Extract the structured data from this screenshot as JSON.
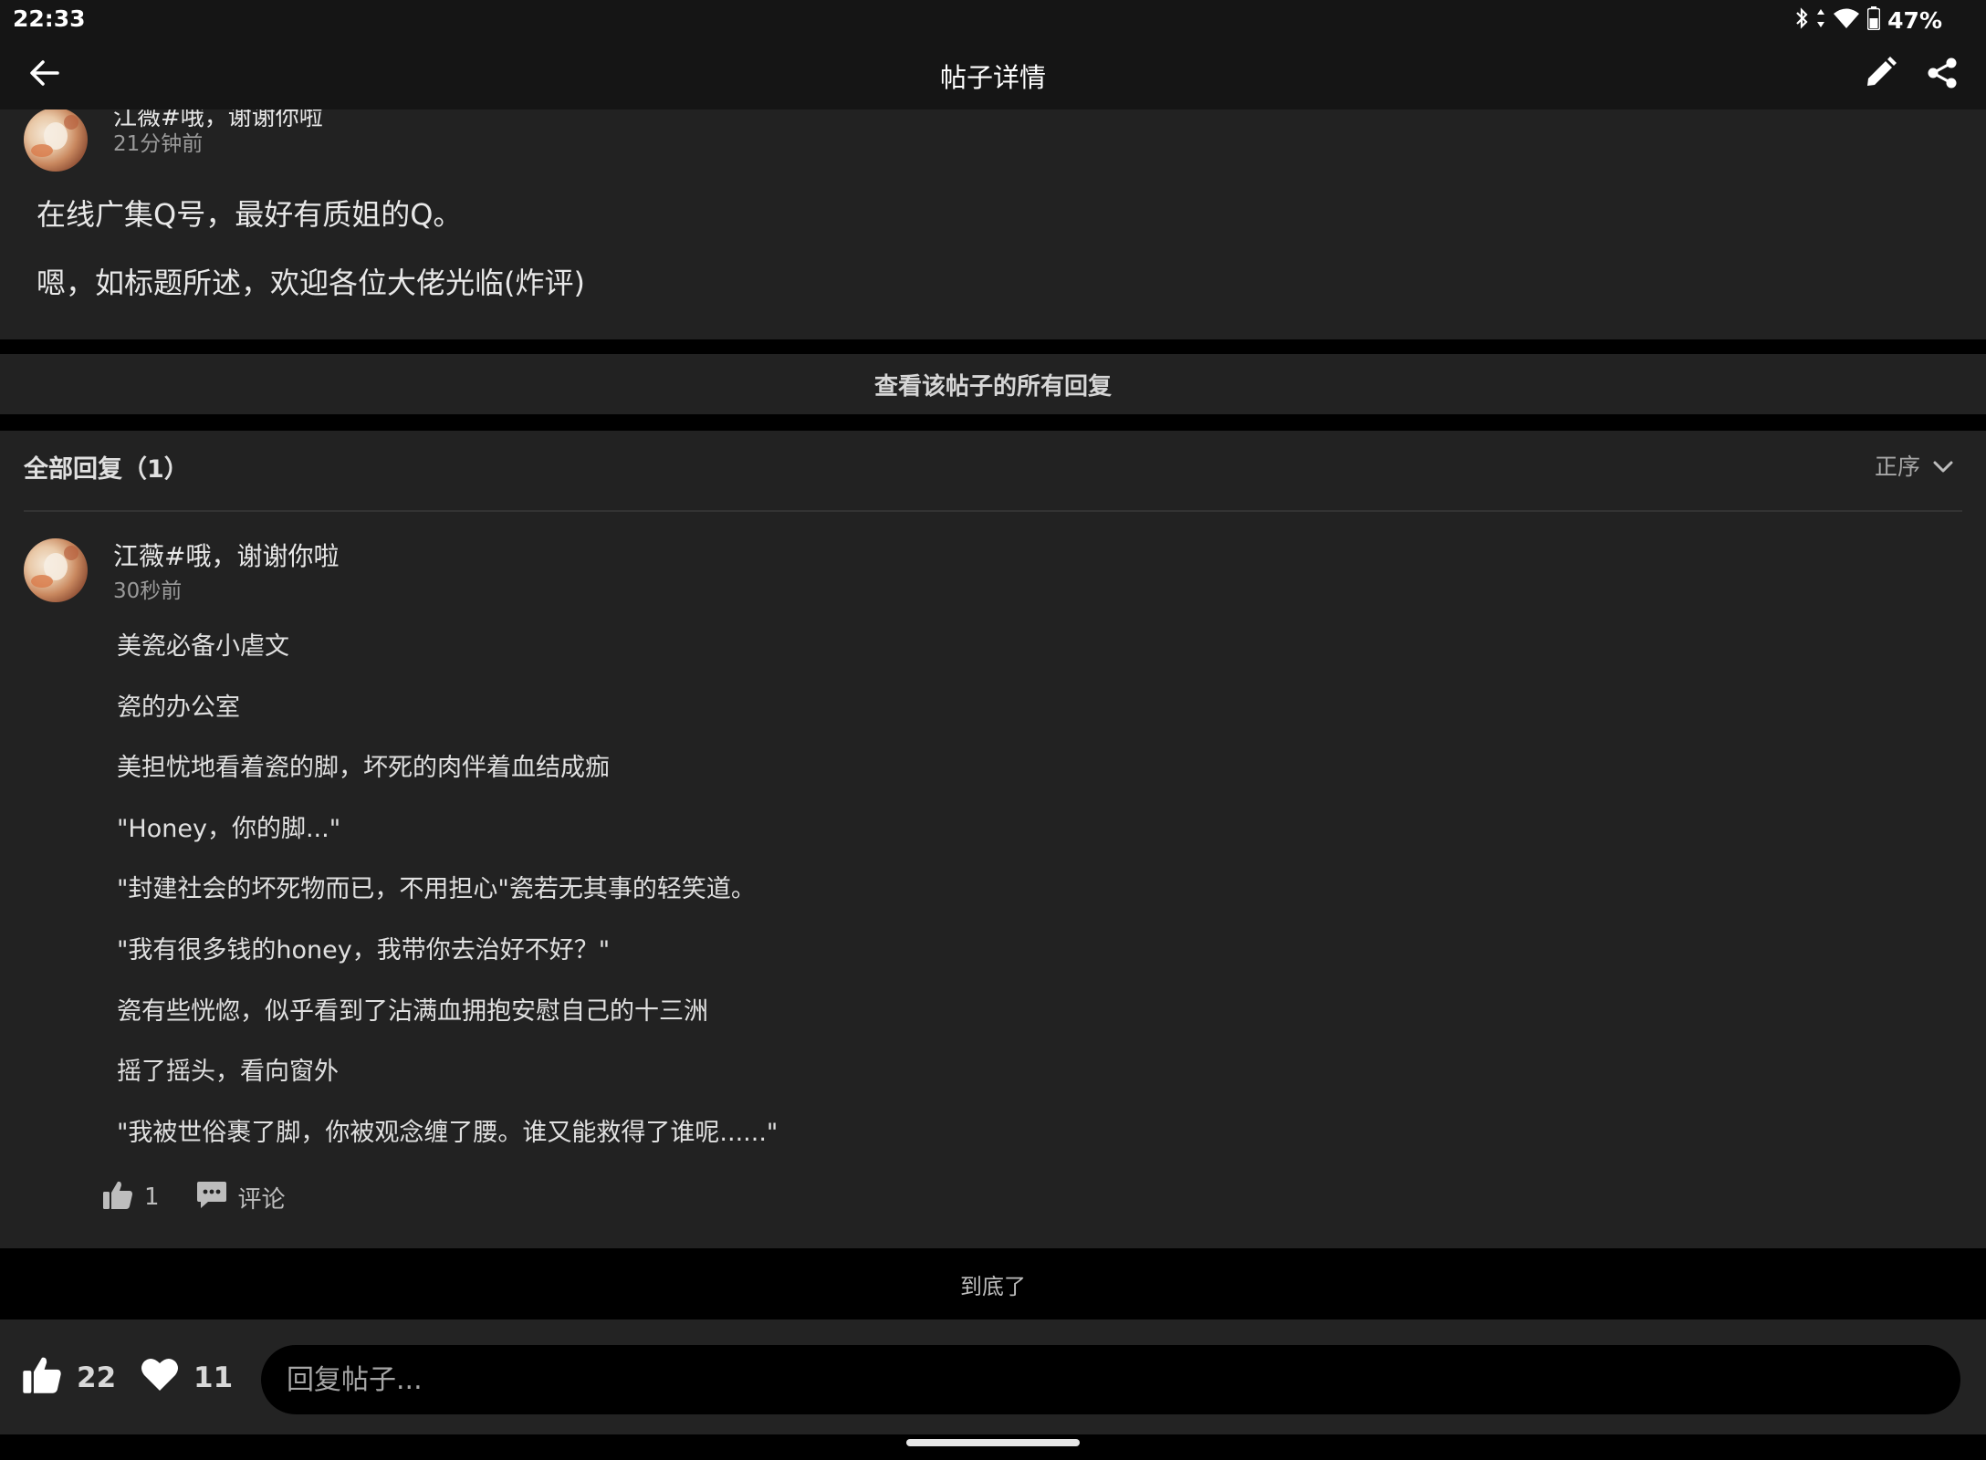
{
  "status_bar": {
    "time": "22:33",
    "battery_percent": "47%",
    "icons": [
      "bluetooth-icon",
      "data-arrows-icon",
      "wifi-icon",
      "battery-icon"
    ]
  },
  "app_bar": {
    "title": "帖子详情",
    "icons": [
      "back-arrow-icon",
      "edit-pencil-icon",
      "share-icon"
    ]
  },
  "post": {
    "author_partial": "江薇#哦，谢谢你啦",
    "time": "21分钟前",
    "title": "在线广集Q号，最好有质姐的Q。",
    "body": "嗯，如标题所述，欢迎各位大佬光临(炸评)"
  },
  "view_all_replies_label": "查看该帖子的所有回复",
  "replies_section": {
    "header": "全部回复（1）",
    "sort_label": "正序"
  },
  "reply": {
    "author": "江薇#哦，谢谢你啦",
    "time": "30秒前",
    "lines": [
      "美瓷必备小虐文",
      "瓷的办公室",
      "美担忧地看着瓷的脚，坏死的肉伴着血结成痂",
      "\"Honey，你的脚...\"",
      "\"封建社会的坏死物而已，不用担心\"瓷若无其事的轻笑道。",
      "\"我有很多钱的honey，我带你去治好不好？\"",
      "瓷有些恍惚，似乎看到了沾满血拥抱安慰自己的十三洲",
      "摇了摇头，看向窗外",
      "\"我被世俗裹了脚，你被观念缠了腰。谁又能救得了谁呢......\""
    ],
    "like_count": "1",
    "comment_label": "评论"
  },
  "end_label": "到底了",
  "bottom_bar": {
    "like_count": "22",
    "favorite_count": "11",
    "reply_placeholder": "回复帖子..."
  },
  "colors": {
    "background": "#000000",
    "card": "#222222",
    "bar": "#151515",
    "text": "#e0e0e0",
    "muted": "#9a9a9a"
  }
}
